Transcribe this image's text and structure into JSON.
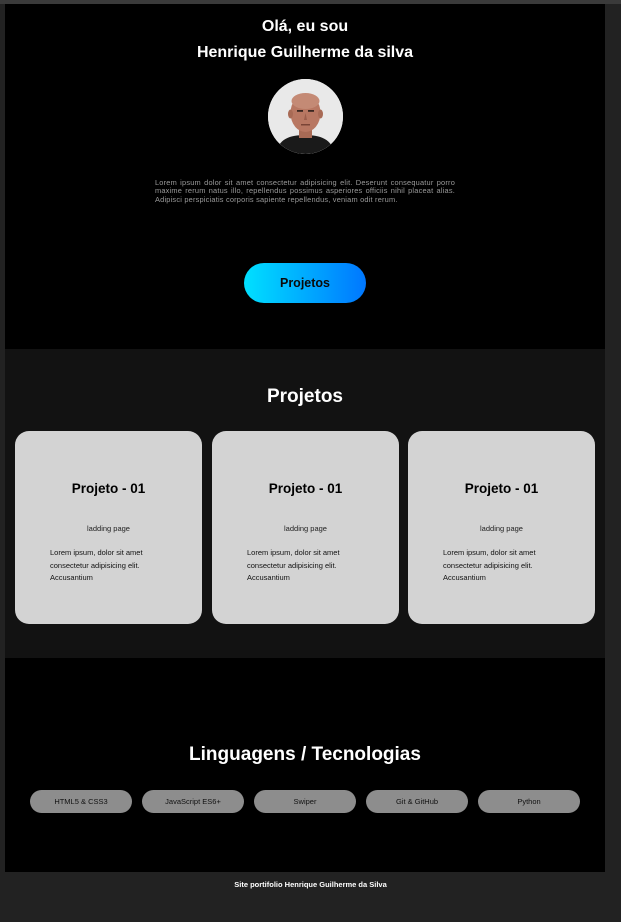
{
  "hero": {
    "greeting": "Olá, eu sou",
    "name": "Henrique Guilherme da silva",
    "photo_alt": "avatar",
    "bio": "Lorem ipsum dolor sit amet consectetur adipisicing elit. Deserunt consequatur porro maxime rerum natus illo, repellendus possimus asperiores officiis nihil placeat alias. Adipisci perspiciatis corporis sapiente repellendus, veniam odit rerum.",
    "button_label": "Projetos"
  },
  "projects": {
    "title": "Projetos",
    "cards": [
      {
        "title": "Projeto - 01",
        "subtitle": "ladding page",
        "description": "Lorem ipsum, dolor sit amet consectetur adipisicing elit. Accusantium"
      },
      {
        "title": "Projeto - 01",
        "subtitle": "ladding page",
        "description": "Lorem ipsum, dolor sit amet consectetur adipisicing elit. Accusantium"
      },
      {
        "title": "Projeto - 01",
        "subtitle": "ladding page",
        "description": "Lorem ipsum, dolor sit amet consectetur adipisicing elit. Accusantium"
      }
    ]
  },
  "tech": {
    "title": "Linguagens / Tecnologias",
    "items": [
      "HTML5 & CSS3",
      "JavaScript ES6+",
      "Swiper",
      "Git & GitHub",
      "Python"
    ]
  },
  "footer": {
    "text": "Site portifolio Henrique Guilherme da Silva"
  },
  "colors": {
    "accent_start": "#00e0ff",
    "accent_end": "#0077ff",
    "card_bg": "#d3d3d3",
    "pill_bg": "#8d8d8d"
  }
}
